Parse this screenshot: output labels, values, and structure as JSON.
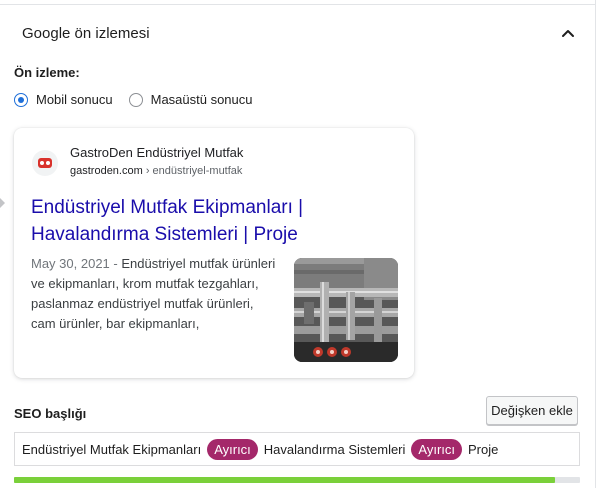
{
  "panel": {
    "title": "Google ön izlemesi",
    "collapse_icon": "chevron-up-icon"
  },
  "preview": {
    "label": "Ön izleme:",
    "options": [
      {
        "label": "Mobil sonucu",
        "checked": true
      },
      {
        "label": "Masaüstü sonucu",
        "checked": false
      }
    ]
  },
  "result": {
    "site_name": "GastroDen Endüstriyel Mutfak",
    "domain": "gastroden.com",
    "breadcrumb": " › endüstriyel-mutfak",
    "title": "Endüstriyel Mutfak Ekipmanları | Havalandırma Sistemleri | Proje",
    "date": "May 30, 2021",
    "date_separator": " - ",
    "description": "Endüstriyel mutfak ürünleri ve ekipmanları, krom mutfak tezgahları, paslanmaz endüstriyel mutfak ürünleri, cam ürünler, bar ekipmanları,",
    "thumbnail_icon": "pipes-thumbnail"
  },
  "seo_title": {
    "label": "SEO başlığı",
    "insert_variable_label": "Değişken ekle",
    "parts": [
      {
        "type": "text",
        "value": "Endüstriyel Mutfak Ekipmanları"
      },
      {
        "type": "variable",
        "value": "Ayırıcı"
      },
      {
        "type": "text",
        "value": "Havalandırma Sistemleri"
      },
      {
        "type": "variable",
        "value": "Ayırıcı"
      },
      {
        "type": "text",
        "value": "Proje"
      }
    ],
    "progress": 0.955
  },
  "colors": {
    "link": "#1a0dab",
    "pill": "#a4286a",
    "progress": "#7ad03a",
    "radio_accent": "#1e6fd9"
  }
}
